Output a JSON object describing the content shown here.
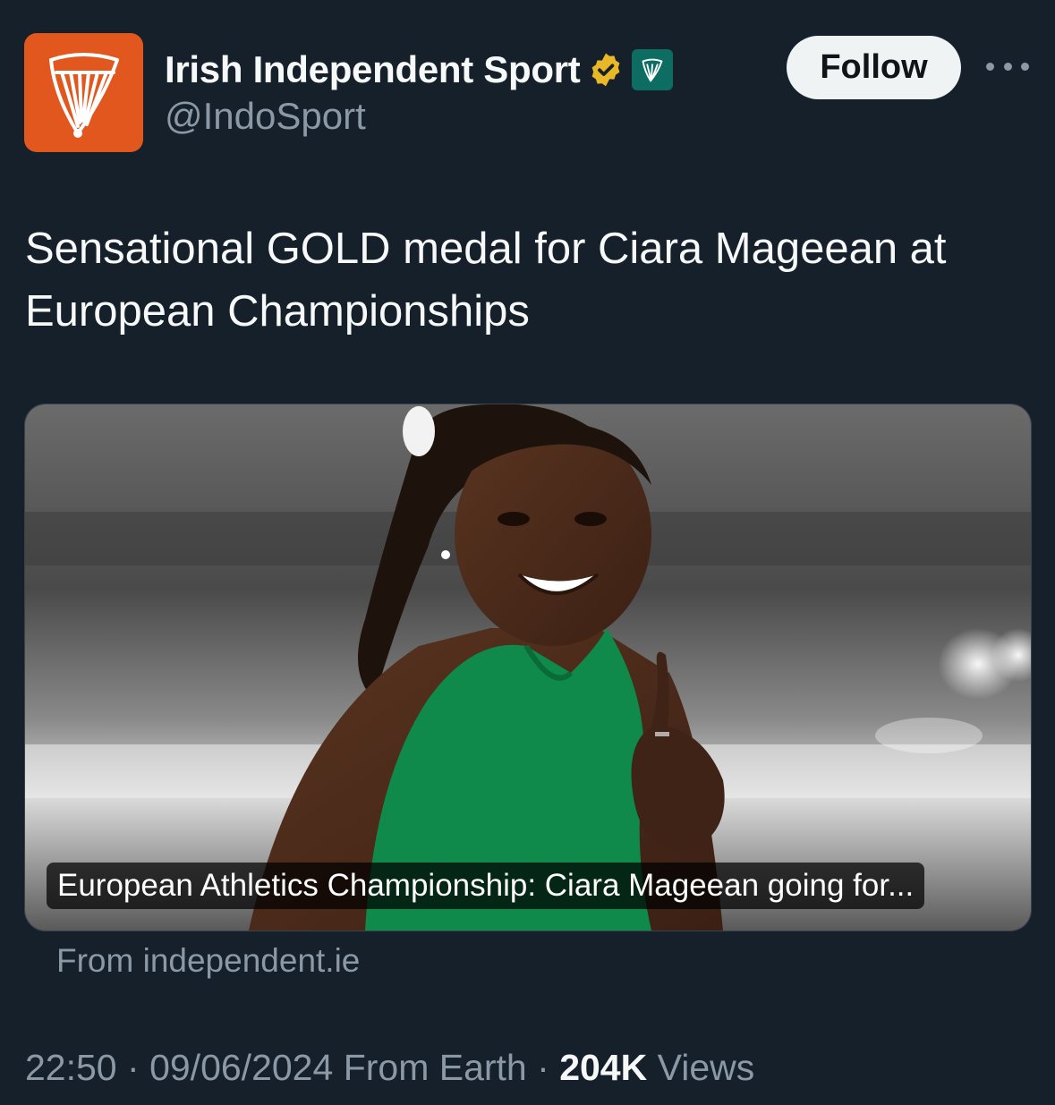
{
  "account": {
    "display_name": "Irish Independent Sport",
    "handle": "@IndoSport",
    "avatar_icon": "harp-logo-icon",
    "avatar_color": "#e2571e",
    "verified_icon": "gold-verified-badge-icon",
    "affiliate_icon": "harp-affiliate-badge-icon"
  },
  "actions": {
    "follow_label": "Follow",
    "more_icon": "more-options-icon"
  },
  "tweet": {
    "text": "Sensational GOLD medal for Ciara Mageean at European Championships"
  },
  "card": {
    "title": "European Athletics Championship: Ciara Mageean going for...",
    "source": "From independent.ie"
  },
  "meta": {
    "time": "22:50",
    "separator": "·",
    "date": "09/06/2024",
    "location": "From Earth",
    "views_count": "204K",
    "views_label": "Views"
  },
  "colors": {
    "background": "#15202b",
    "text_primary": "#f7f9f9",
    "text_secondary": "#8b98a5",
    "follow_bg": "#eff3f4"
  }
}
